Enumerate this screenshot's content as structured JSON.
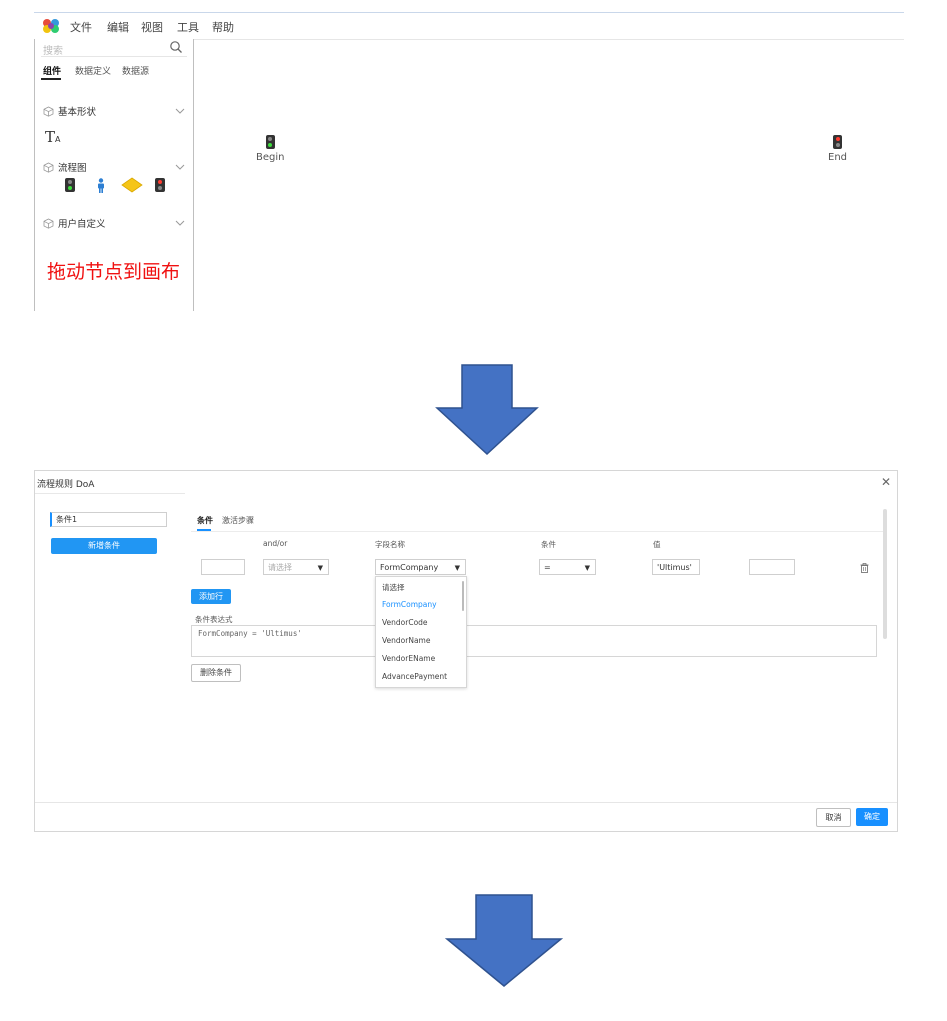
{
  "designer": {
    "menu": [
      "文件",
      "编辑",
      "视图",
      "工具",
      "帮助"
    ],
    "search_placeholder": "搜索",
    "tabs": [
      "组件",
      "数据定义",
      "数据源"
    ],
    "groups": [
      "基本形状",
      "流程图",
      "用户自定义"
    ],
    "text_tool": {
      "main": "T",
      "sub": "A"
    },
    "drag_hint": "拖动节点到画布",
    "nodes": {
      "begin": "Begin",
      "end": "End"
    }
  },
  "dialog": {
    "title": "流程规则 DoA",
    "close": "✕",
    "condition_item": "条件1",
    "add_condition": "新增条件",
    "tabs": [
      "条件",
      "激活步骤"
    ],
    "columns": [
      "and/or",
      "字段名称",
      "条件",
      "值"
    ],
    "row": {
      "andor_placeholder": "请选择",
      "field_value": "FormCompany",
      "operator_value": "=",
      "value_value": "'Ultimus'"
    },
    "dropdown_options": [
      "请选择",
      "FormCompany",
      "VendorCode",
      "VendorName",
      "VendorEName",
      "AdvancePayment"
    ],
    "add_row": "添加行",
    "expression_label": "条件表达式",
    "expression": "FormCompany = 'Ultimus'",
    "delete_condition": "删除条件",
    "cancel": "取消",
    "ok": "确定"
  },
  "colors": {
    "accent": "#1890ff",
    "arrow": "#4472c4",
    "hint": "#f01010"
  }
}
